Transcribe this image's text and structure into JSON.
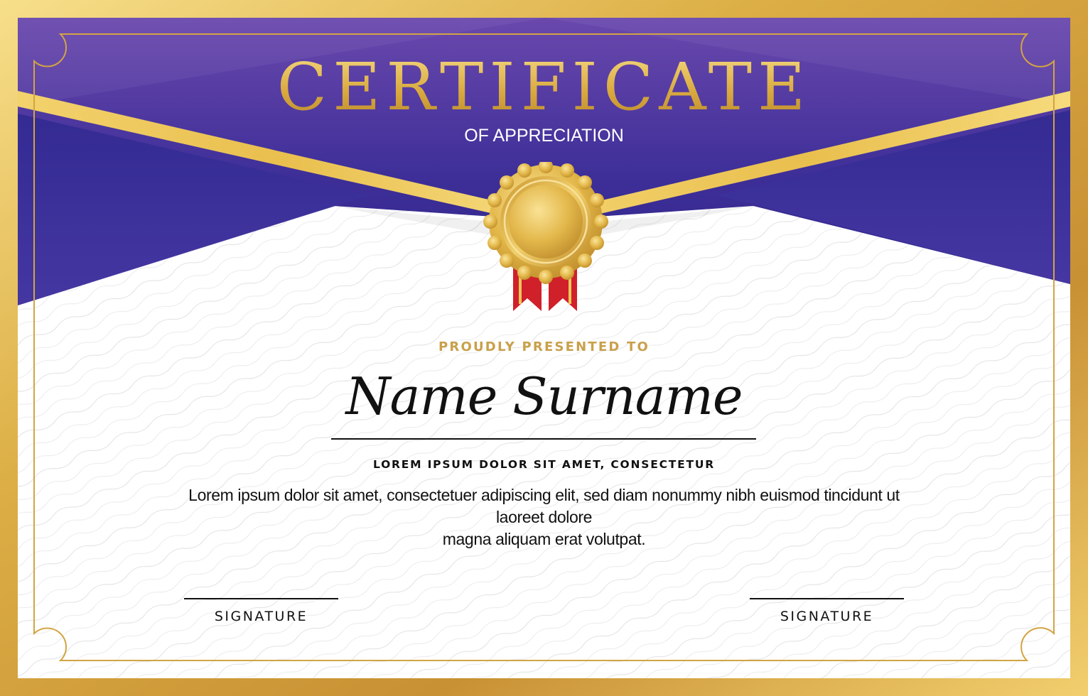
{
  "certificate": {
    "title": "CERTIFICATE",
    "subtitle": "OF APPRECIATION",
    "presented_label": "PROUDLY PRESENTED TO",
    "recipient_name": "Name Surname",
    "subheading": "LOREM IPSUM DOLOR SIT AMET, CONSECTETUR",
    "body_line_1": "Lorem ipsum dolor sit amet, consectetuer adipiscing elit, sed diam nonummy nibh euismod tincidunt ut laoreet dolore",
    "body_line_2": "magna aliquam erat volutpat.",
    "signature_left": "SIGNATURE",
    "signature_right": "SIGNATURE"
  },
  "colors": {
    "purple_top": "#5b3fa8",
    "purple_dark": "#2e2790",
    "gold": "#d9aa3f",
    "gold_light": "#f6dc86",
    "ribbon_red": "#d0202a",
    "ink": "#111111"
  },
  "icons": {
    "seal": "gold-seal-medal-icon"
  }
}
